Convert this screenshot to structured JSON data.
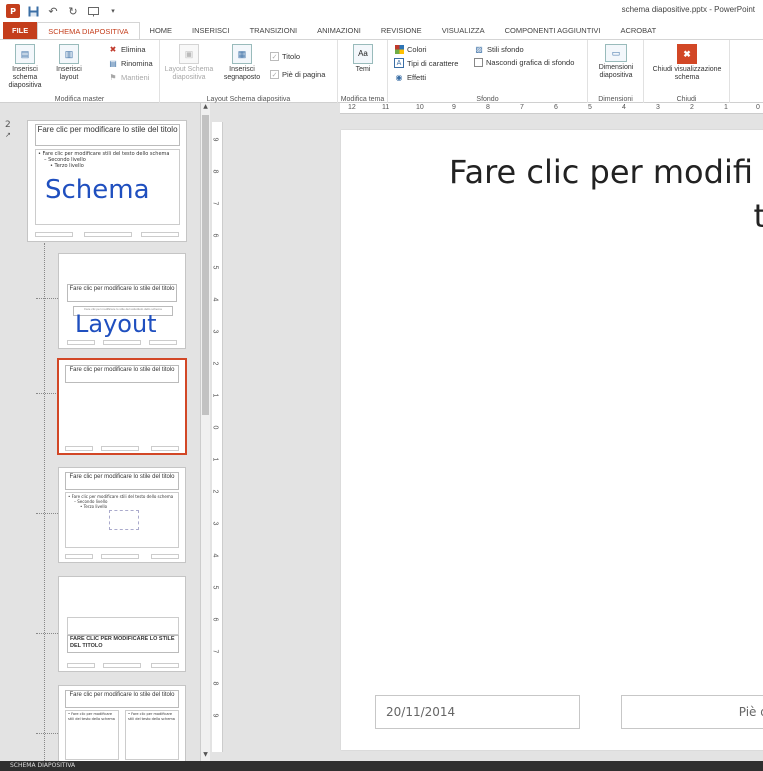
{
  "window": {
    "title": "schema diapositive.pptx - PowerPoint"
  },
  "qat": {
    "app_icon": "P",
    "save_icon": "save-icon",
    "undo_icon": "undo-icon",
    "redo_icon": "redo-icon",
    "start_icon": "presentation-start-icon"
  },
  "tabs": [
    {
      "label": "FILE"
    },
    {
      "label": "SCHEMA DIAPOSITIVA"
    },
    {
      "label": "HOME"
    },
    {
      "label": "INSERISCI"
    },
    {
      "label": "TRANSIZIONI"
    },
    {
      "label": "ANIMAZIONI"
    },
    {
      "label": "REVISIONE"
    },
    {
      "label": "VISUALIZZA"
    },
    {
      "label": "COMPONENTI AGGIUNTIVI"
    },
    {
      "label": "ACROBAT"
    }
  ],
  "ribbon": {
    "modifica_master": {
      "label": "Modifica master",
      "insert_master": "Inserisci schema diapositiva",
      "insert_layout": "Inserisci layout",
      "elimina": "Elimina",
      "rinomina": "Rinomina",
      "mantieni": "Mantieni"
    },
    "layout_schema": {
      "label": "Layout Schema diapositiva",
      "layout_schema": "Layout Schema diapositiva",
      "inserisci_segnaposto": "Inserisci segnaposto",
      "titolo": "Titolo",
      "pie_di_pagina": "Piè di pagina"
    },
    "modifica_tema": {
      "label": "Modifica tema",
      "temi": "Temi"
    },
    "sfondo": {
      "label": "Sfondo",
      "colori": "Colori",
      "tipi_carattere": "Tipi di carattere",
      "effetti": "Effetti",
      "stili_sfondo": "Stili sfondo",
      "nascondi_grafica": "Nascondi grafica di sfondo"
    },
    "dimensioni": {
      "label": "Dimensioni",
      "dimensioni_diapositiva": "Dimensioni diapositiva"
    },
    "chiudi": {
      "label": "Chiudi",
      "chiudi_visualizzazione": "Chiudi visualizzazione schema"
    }
  },
  "ruler": {
    "h": [
      "12",
      "11",
      "10",
      "9",
      "8",
      "7",
      "6",
      "5",
      "4",
      "3",
      "2",
      "1",
      "0"
    ],
    "v": [
      "9",
      "8",
      "7",
      "6",
      "5",
      "4",
      "3",
      "2",
      "1",
      "0",
      "1",
      "2",
      "3",
      "4",
      "5",
      "6",
      "7",
      "8",
      "9"
    ]
  },
  "thumbnails": {
    "slide_number": "2",
    "master": {
      "title": "Fare clic per modificare lo stile del titolo",
      "body_l1": "• Fare clic per modificare stili del testo dello schema",
      "body_l2": "– Secondo livello",
      "body_l3": "• Terzo livello",
      "overlay": "Schema"
    },
    "layout1": {
      "title": "Fare clic per modificare lo stile del titolo",
      "subtitle": "Fare clic per modificare lo stile del sottotitolo dello schema",
      "overlay": "Layout"
    },
    "layout2": {
      "title": "Fare clic per modificare lo stile del titolo"
    },
    "layout3": {
      "title": "Fare clic per modificare lo stile del titolo",
      "body_l1": "• Fare clic per modificare stili del testo dello schema",
      "body_l2": "– Secondo livello",
      "body_l3": "• Terzo livello"
    },
    "layout4": {
      "title": "FARE CLIC PER MODIFICARE LO STILE DEL TITOLO"
    },
    "layout5": {
      "title": "Fare clic per modificare lo stile del titolo",
      "col1": "• Fare clic per modificare stili del testo dello schema",
      "col2": "• Fare clic per modificare stili del testo dello schema"
    }
  },
  "slide": {
    "title_line1": "Fare clic per modifi",
    "title_line2": "tito",
    "footer_date": "20/11/2014",
    "footer_center": "Piè di pa"
  },
  "statusbar": {
    "text": "SCHEMA DIAPOSITIVA"
  },
  "colors": {
    "accent": "#c43e1c",
    "selection": "#d24726",
    "overlay_text": "#1f4fbf"
  }
}
